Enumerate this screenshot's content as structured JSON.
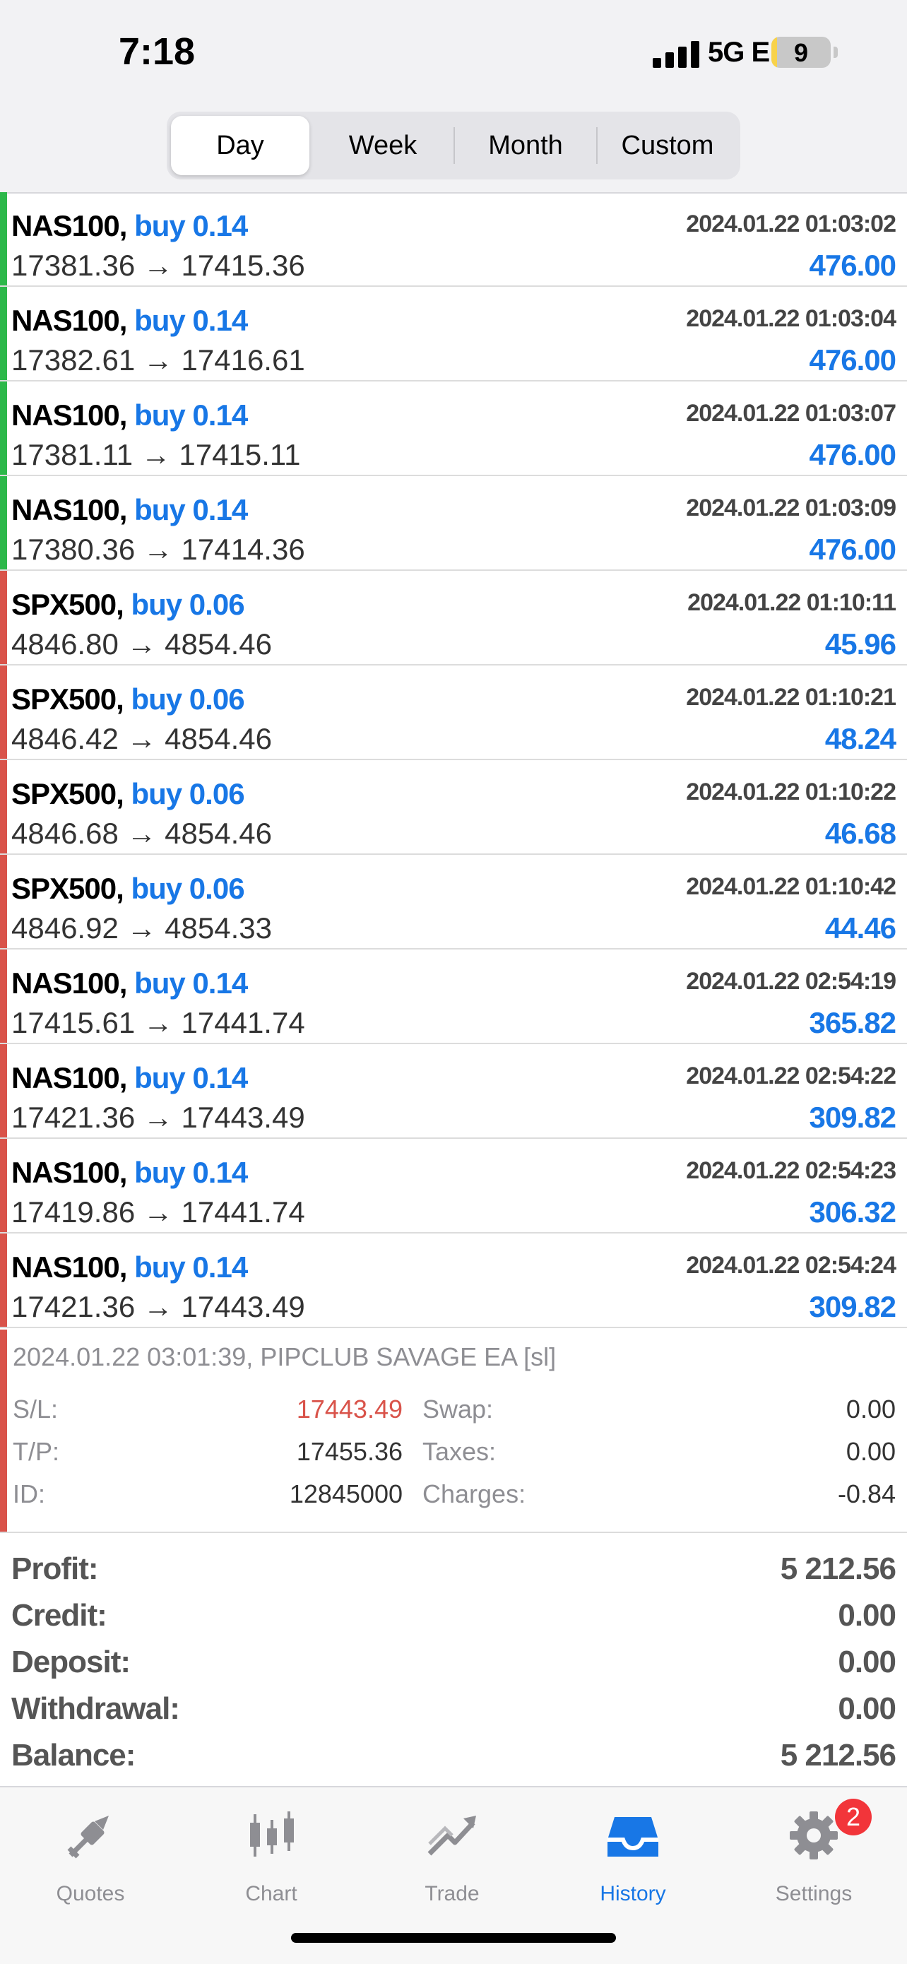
{
  "status": {
    "time": "7:18",
    "network": "5G E",
    "battery": "9",
    "battery_level": 0.09
  },
  "segments": [
    {
      "label": "Day",
      "active": true
    },
    {
      "label": "Week",
      "active": false
    },
    {
      "label": "Month",
      "active": false
    },
    {
      "label": "Custom",
      "active": false
    }
  ],
  "deals": [
    {
      "symbol": "NAS100,",
      "side": "buy 0.14",
      "prices": "17381.36 → 17415.36",
      "time": "2024.01.22 01:03:02",
      "profit": "476.00",
      "bar_color": "#2db84a"
    },
    {
      "symbol": "NAS100,",
      "side": "buy 0.14",
      "prices": "17382.61 → 17416.61",
      "time": "2024.01.22 01:03:04",
      "profit": "476.00",
      "bar_color": "#2db84a"
    },
    {
      "symbol": "NAS100,",
      "side": "buy 0.14",
      "prices": "17381.11 → 17415.11",
      "time": "2024.01.22 01:03:07",
      "profit": "476.00",
      "bar_color": "#2db84a"
    },
    {
      "symbol": "NAS100,",
      "side": "buy 0.14",
      "prices": "17380.36 → 17414.36",
      "time": "2024.01.22 01:03:09",
      "profit": "476.00",
      "bar_color": "#2db84a"
    },
    {
      "symbol": "SPX500,",
      "side": "buy 0.06",
      "prices": "4846.80 → 4854.46",
      "time": "2024.01.22 01:10:11",
      "profit": "45.96",
      "bar_color": "#d9534a"
    },
    {
      "symbol": "SPX500,",
      "side": "buy 0.06",
      "prices": "4846.42 → 4854.46",
      "time": "2024.01.22 01:10:21",
      "profit": "48.24",
      "bar_color": "#d9534a"
    },
    {
      "symbol": "SPX500,",
      "side": "buy 0.06",
      "prices": "4846.68 → 4854.46",
      "time": "2024.01.22 01:10:22",
      "profit": "46.68",
      "bar_color": "#d9534a"
    },
    {
      "symbol": "SPX500,",
      "side": "buy 0.06",
      "prices": "4846.92 → 4854.33",
      "time": "2024.01.22 01:10:42",
      "profit": "44.46",
      "bar_color": "#d9534a"
    },
    {
      "symbol": "NAS100,",
      "side": "buy 0.14",
      "prices": "17415.61 → 17441.74",
      "time": "2024.01.22 02:54:19",
      "profit": "365.82",
      "bar_color": "#d9534a"
    },
    {
      "symbol": "NAS100,",
      "side": "buy 0.14",
      "prices": "17421.36 → 17443.49",
      "time": "2024.01.22 02:54:22",
      "profit": "309.82",
      "bar_color": "#d9534a"
    },
    {
      "symbol": "NAS100,",
      "side": "buy 0.14",
      "prices": "17419.86 → 17441.74",
      "time": "2024.01.22 02:54:23",
      "profit": "306.32",
      "bar_color": "#d9534a"
    },
    {
      "symbol": "NAS100,",
      "side": "buy 0.14",
      "prices": "17421.36 → 17443.49",
      "time": "2024.01.22 02:54:24",
      "profit": "309.82",
      "bar_color": "#d9534a"
    }
  ],
  "details": {
    "comment": "2024.01.22 03:01:39, PIPCLUB SAVAGE EA [sl]",
    "sl_label": "S/L:",
    "sl_value": "17443.49",
    "tp_label": "T/P:",
    "tp_value": "17455.36",
    "id_label": "ID:",
    "id_value": "12845000",
    "swap_label": "Swap:",
    "swap_value": "0.00",
    "taxes_label": "Taxes:",
    "taxes_value": "0.00",
    "charges_label": "Charges:",
    "charges_value": "-0.84"
  },
  "summary": [
    {
      "label": "Profit:",
      "value": "5 212.56"
    },
    {
      "label": "Credit:",
      "value": "0.00"
    },
    {
      "label": "Deposit:",
      "value": "0.00"
    },
    {
      "label": "Withdrawal:",
      "value": "0.00"
    },
    {
      "label": "Balance:",
      "value": "5 212.56"
    }
  ],
  "tabs": [
    {
      "label": "Quotes",
      "icon": "quotes-icon",
      "active": false
    },
    {
      "label": "Chart",
      "icon": "chart-icon",
      "active": false
    },
    {
      "label": "Trade",
      "icon": "trade-icon",
      "active": false
    },
    {
      "label": "History",
      "icon": "history-icon",
      "active": true
    },
    {
      "label": "Settings",
      "icon": "gear-icon",
      "active": false,
      "badge": "2"
    }
  ],
  "colors": {
    "accent": "#1877e6",
    "profit_bar_green": "#2db84a",
    "loss_bar_red": "#d9534a",
    "badge_red": "#f2353a"
  }
}
